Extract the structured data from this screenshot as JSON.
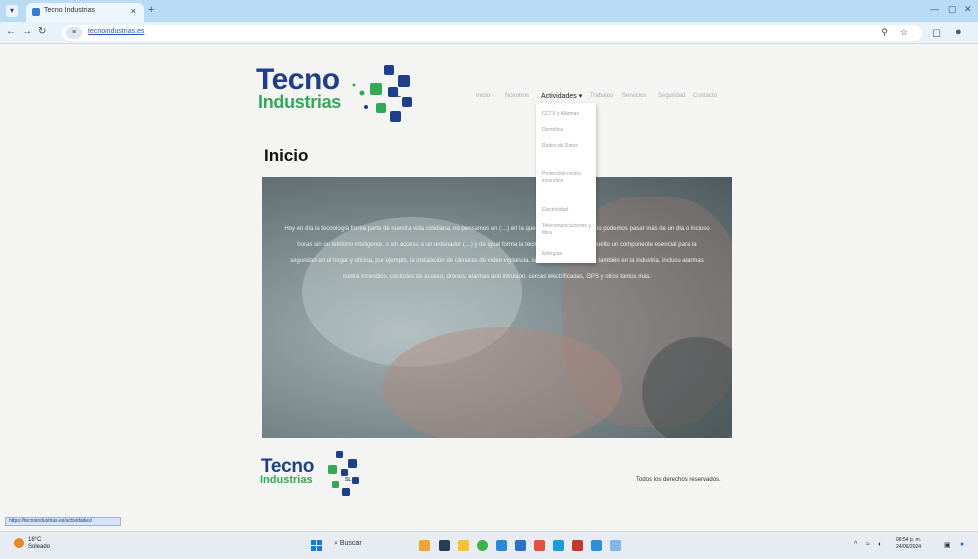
{
  "browser": {
    "tab_title": "Tecno Industrias",
    "tab_close": "×",
    "new_tab": "+",
    "url": "tecnoindustrias.es",
    "zoom_icon": "magnifier-icon",
    "colors": {
      "tabbar": "#b9dcf4",
      "toolbar": "#e9f2f9"
    }
  },
  "logo": {
    "line1": "Tecno",
    "line2": "Industrias",
    "suffix": "SL"
  },
  "nav": {
    "items": [
      "Inicio",
      "Nosotros",
      "Actividades",
      "Trabajos",
      "Servicios",
      "Seguridad",
      "Contacto"
    ],
    "active_index": 2
  },
  "dropdown": {
    "items": [
      "CCTV y Alarmas",
      "Domótica",
      "Redes de Datos",
      "Protección contra incendios",
      "Electricidad",
      "Telecomunicaciones y fibra",
      "Energías"
    ]
  },
  "page": {
    "title": "Inicio",
    "hero_text": "Hoy en día la tecnología forma parte de nuestra vida cotidiana, no pensamos en (…) en la que hayan muchos y casi no podemos pasar más de un día o incluso horas sin un teléfono inteligente, o sin acceso a un ordenador (…) y de igual forma la tecnología también se ha vuelto un componente esencial para la seguridad en el hogar y oficina, por ejemplo, la instalación de cámaras de video vigilancia, sistemas de cierre como también en la industria, incluso alarmas contra incendios, controles de acceso, drones, alarmas anti intrusión, cercas electrificadas, GPS y otros tantos más."
  },
  "footer": {
    "copyright": "Todos los derechos reservados."
  },
  "statusbar": {
    "text": "https://tecnoindustrias.es/actividades/"
  },
  "taskbar": {
    "weather_temp": "18°C",
    "weather_desc": "Soleado",
    "search": "Buscar",
    "time": "06:54 p. m.",
    "date": "24/06/2024",
    "app_icons": [
      "files-icon",
      "explorer-icon",
      "folder-icon",
      "chrome-icon",
      "store-icon",
      "mail-icon",
      "app-icon",
      "edge-icon",
      "office-icon",
      "photos-icon",
      "app-icon"
    ]
  }
}
